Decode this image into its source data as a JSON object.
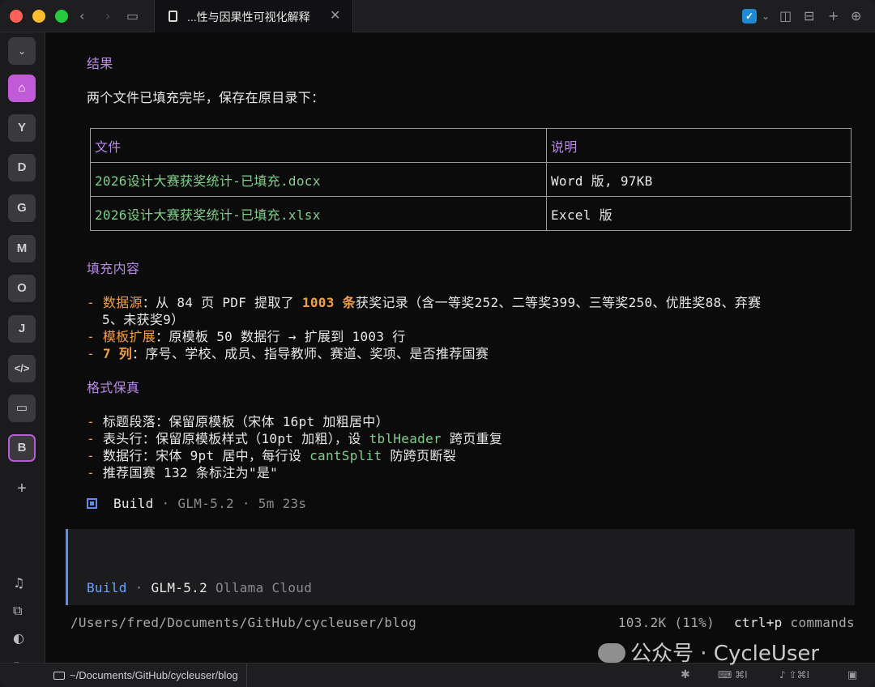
{
  "tab": {
    "title": "...性与因果性可视化解释",
    "close": "✕"
  },
  "sidebar": {
    "items": [
      {
        "label": "Y"
      },
      {
        "label": "D"
      },
      {
        "label": "G"
      },
      {
        "label": "M"
      },
      {
        "label": "O"
      },
      {
        "label": "J"
      }
    ],
    "active_label": "B",
    "add": "+"
  },
  "content": {
    "result_heading": "结果",
    "result_text": "两个文件已填充完毕，保存在原目录下：",
    "table": {
      "headers": [
        "文件",
        "说明"
      ],
      "rows": [
        {
          "file": "2026设计大赛获奖统计-已填充.docx",
          "desc": "Word 版, 97KB"
        },
        {
          "file": "2026设计大赛获奖统计-已填充.xlsx",
          "desc": "Excel 版"
        }
      ]
    },
    "fill_heading": "填充内容",
    "fill": {
      "b1_key": "数据源",
      "b1_a": "：从 84 页 PDF 提取了 ",
      "b1_num": "1003 条",
      "b1_b": "获奖记录（含一等奖252、二等奖399、三等奖250、优胜奖88、弃赛",
      "b1_c": "5、未获奖9）",
      "b2_key": "模板扩展",
      "b2_text": "：原模板 50 数据行 → 扩展到 1003 行",
      "b3_key": "7 列",
      "b3_text": "：序号、学校、成员、指导教师、赛道、奖项、是否推荐国赛"
    },
    "format_heading": "格式保真",
    "format": {
      "f1": "标题段落：保留原模板（宋体 16pt 加粗居中）",
      "f2_a": "表头行：保留原模板样式（10pt 加粗），设 ",
      "f2_code": "tblHeader",
      "f2_b": " 跨页重复",
      "f3_a": "数据行：宋体 9pt 居中，每行设 ",
      "f3_code": "cantSplit",
      "f3_b": " 防跨页断裂",
      "f4": "推荐国赛 132 条标注为\"是\""
    },
    "build": {
      "mode": "Build",
      "sep": "·",
      "model": "GLM-5.2",
      "duration": "5m 23s"
    }
  },
  "input": {
    "mode": "Build",
    "sep": "·",
    "model": "GLM-5.2",
    "provider": "Ollama Cloud"
  },
  "status": {
    "path": "/Users/fred/Documents/GitHub/cycleuser/blog",
    "tokens": "103.2K (11%)",
    "shortcut": "ctrl+p",
    "shortcut_label": "commands"
  },
  "bottom": {
    "path": "~/Documents/GitHub/cycleuser/blog",
    "kbd_shortcut": "⌘I",
    "mic_shortcut": "⇧⌘I"
  },
  "watermark": {
    "text": "公众号 · CycleUser"
  }
}
